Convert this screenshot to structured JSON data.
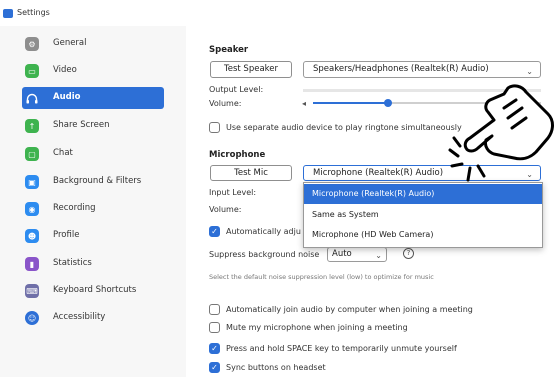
{
  "window": {
    "title": "Settings"
  },
  "sidebar": {
    "items": [
      {
        "label": "General",
        "icon": "gear-icon",
        "color": "#8e8e8e",
        "active": false
      },
      {
        "label": "Video",
        "icon": "video-icon",
        "color": "#3eb34f",
        "active": false
      },
      {
        "label": "Audio",
        "icon": "headphones-icon",
        "color": "#2d6fd6",
        "active": true
      },
      {
        "label": "Share Screen",
        "icon": "share-screen-icon",
        "color": "#3eb34f",
        "active": false
      },
      {
        "label": "Chat",
        "icon": "chat-icon",
        "color": "#3eb34f",
        "active": false
      },
      {
        "label": "Background & Filters",
        "icon": "background-icon",
        "color": "#2d8cf0",
        "active": false
      },
      {
        "label": "Recording",
        "icon": "recording-icon",
        "color": "#2d8cf0",
        "active": false
      },
      {
        "label": "Profile",
        "icon": "profile-icon",
        "color": "#2d8cf0",
        "active": false
      },
      {
        "label": "Statistics",
        "icon": "statistics-icon",
        "color": "#8a55c9",
        "active": false
      },
      {
        "label": "Keyboard Shortcuts",
        "icon": "keyboard-icon",
        "color": "#6f6fa8",
        "active": false
      },
      {
        "label": "Accessibility",
        "icon": "accessibility-icon",
        "color": "#2d6fd6",
        "active": false
      }
    ]
  },
  "speaker": {
    "title": "Speaker",
    "test_button": "Test Speaker",
    "device": "Speakers/Headphones (Realtek(R) Audio)",
    "output_level_label": "Output Level:",
    "volume_label": "Volume:",
    "volume_level": 0.33
  },
  "ringtone": {
    "label": "Use separate audio device to play ringtone simultaneously",
    "checked": false
  },
  "microphone": {
    "title": "Microphone",
    "test_button": "Test Mic",
    "device": "Microphone (Realtek(R) Audio)",
    "input_level_label": "Input Level:",
    "volume_label": "Volume:",
    "auto_adjust_label": "Automatically adju",
    "auto_adjust_checked": true,
    "suppress_label": "Suppress background noise",
    "suppress_value": "Auto",
    "suppress_hint": "Select the default noise suppression level (low) to optimize for music",
    "dropdown_options": [
      "Microphone (Realtek(R) Audio)",
      "Same as System",
      "Microphone (HD Web Camera)"
    ]
  },
  "options": [
    {
      "label": "Automatically join audio by computer when joining a meeting",
      "checked": false
    },
    {
      "label": "Mute my microphone when joining a meeting",
      "checked": false
    },
    {
      "label": "Press and hold SPACE key to temporarily unmute yourself",
      "checked": true
    },
    {
      "label": "Sync buttons on headset",
      "checked": true
    }
  ],
  "accent_color": "#2d6fd6"
}
